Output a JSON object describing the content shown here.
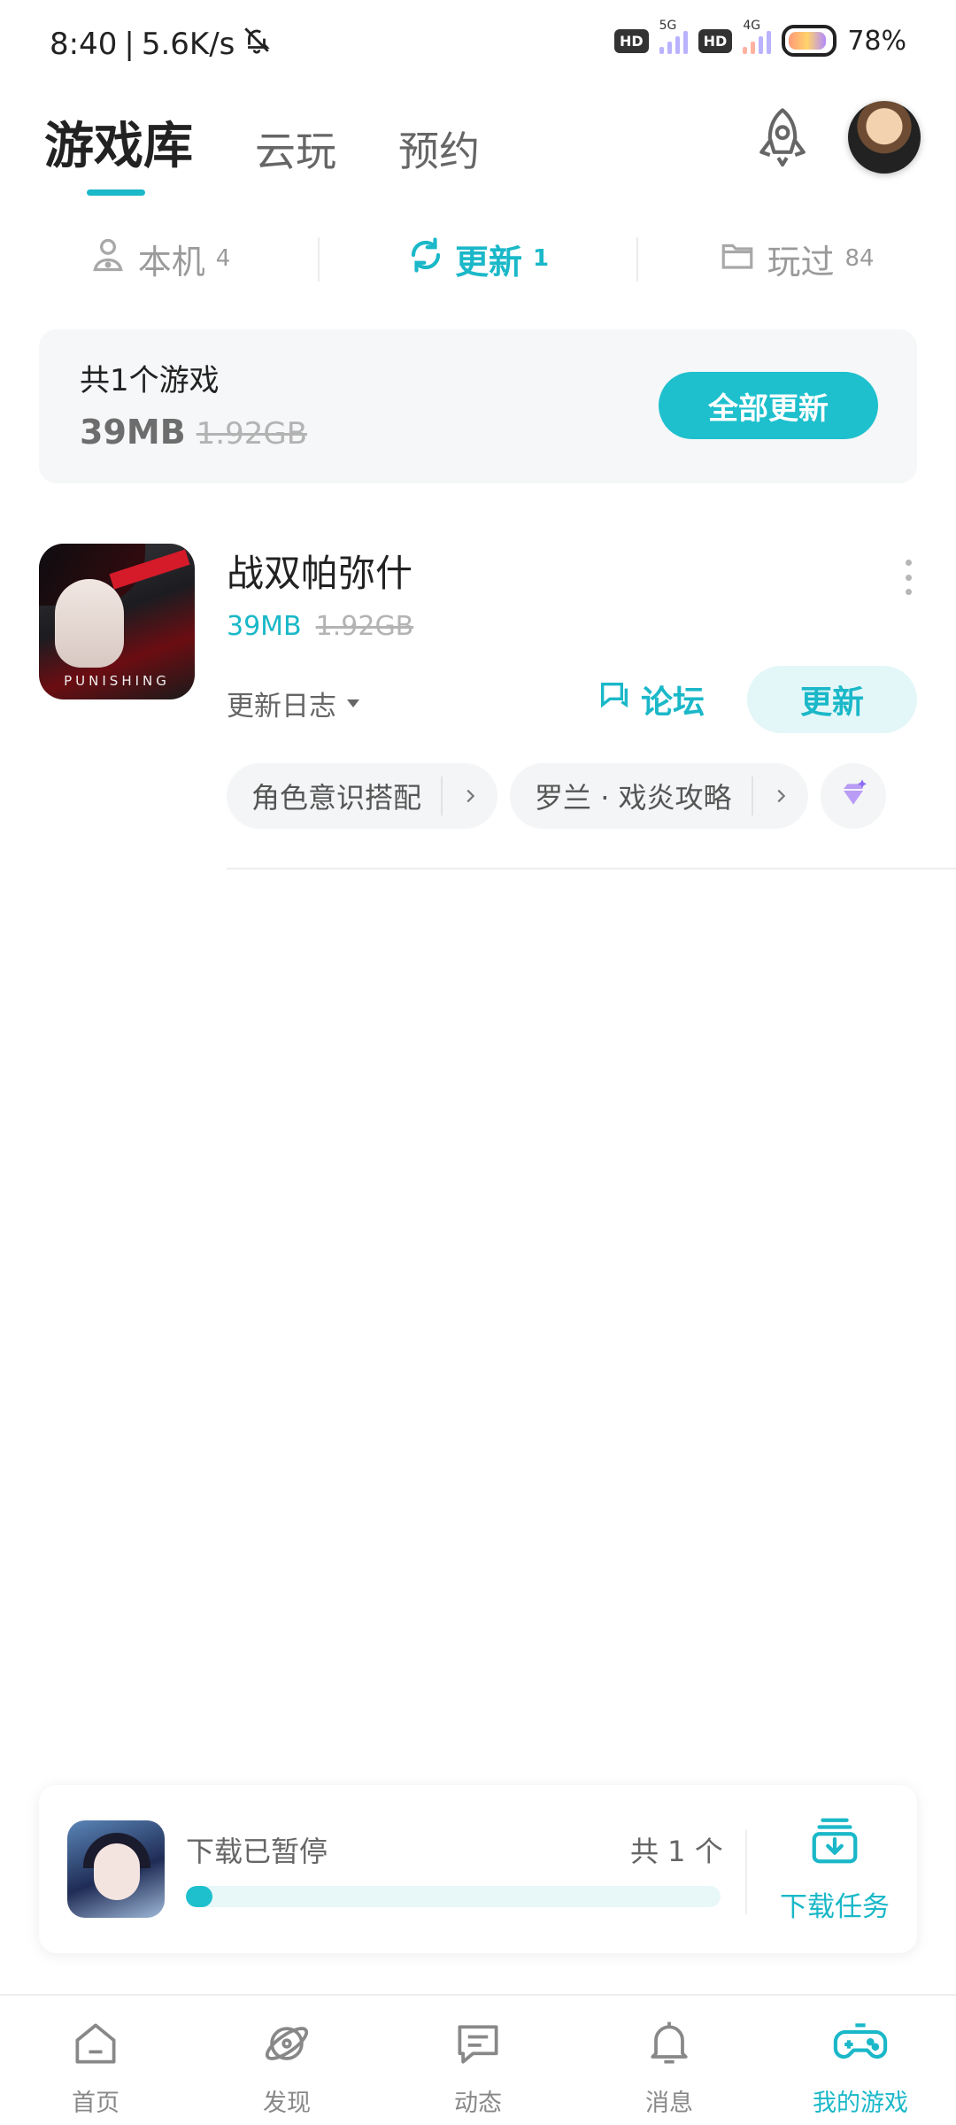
{
  "status_bar": {
    "time": "8:40",
    "speed": "5.6K/s",
    "net1": "5G",
    "net2": "4G",
    "hd": "HD",
    "battery": "78%"
  },
  "header": {
    "tabs": [
      {
        "label": "游戏库",
        "active": true
      },
      {
        "label": "云玩",
        "active": false
      },
      {
        "label": "预约",
        "active": false
      }
    ]
  },
  "subtabs": [
    {
      "label": "本机",
      "count": "4",
      "icon": "gamepad-user-icon",
      "active": false
    },
    {
      "label": "更新",
      "count": "1",
      "icon": "refresh-icon",
      "active": true
    },
    {
      "label": "玩过",
      "count": "84",
      "icon": "folder-icon",
      "active": false
    }
  ],
  "summary": {
    "count_text": "共1个游戏",
    "size": "39MB",
    "size_full": "1.92GB",
    "update_all_label": "全部更新"
  },
  "game": {
    "title": "战双帕弥什",
    "size": "39MB",
    "size_full": "1.92GB",
    "icon_logo": "PUNISHING",
    "changelog_label": "更新日志",
    "forum_label": "论坛",
    "update_label": "更新",
    "chips": [
      "角色意识搭配",
      "罗兰 · 戏炎攻略"
    ]
  },
  "download": {
    "status": "下载已暂停",
    "count": "共 1 个",
    "progress": 0.05,
    "task_label": "下载任务"
  },
  "bottom_nav": [
    {
      "label": "首页",
      "icon": "home-icon",
      "active": false
    },
    {
      "label": "发现",
      "icon": "planet-icon",
      "active": false
    },
    {
      "label": "动态",
      "icon": "chat-icon",
      "active": false
    },
    {
      "label": "消息",
      "icon": "bell-icon",
      "active": false
    },
    {
      "label": "我的游戏",
      "icon": "gamepad-icon",
      "active": true
    }
  ],
  "colors": {
    "accent": "#1ab8c8",
    "accent_light": "#e4f7f8"
  }
}
